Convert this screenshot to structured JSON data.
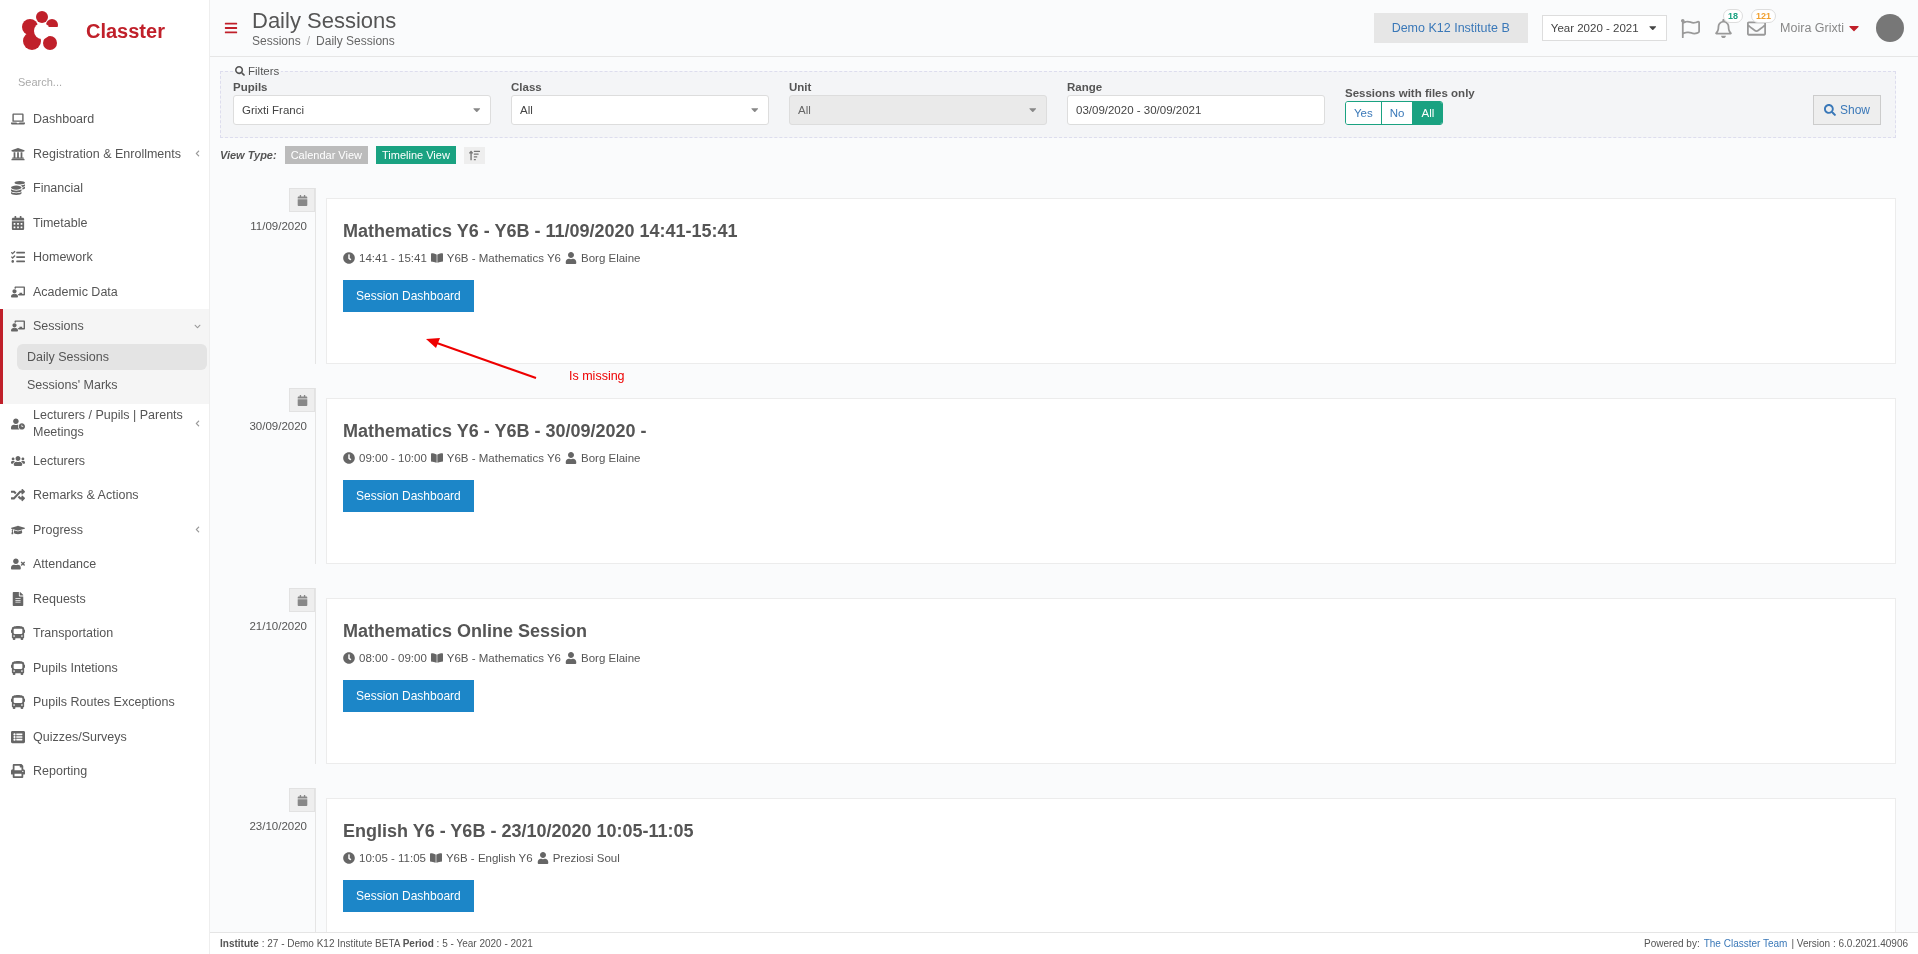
{
  "brand": {
    "name": "Classter"
  },
  "sidebar": {
    "search_placeholder": "Search...",
    "items": [
      {
        "label": "Dashboard"
      },
      {
        "label": "Registration & Enrollments",
        "expanded": false
      },
      {
        "label": "Financial"
      },
      {
        "label": "Timetable"
      },
      {
        "label": "Homework"
      },
      {
        "label": "Academic Data"
      },
      {
        "label": "Sessions",
        "expanded": true,
        "children": [
          {
            "label": "Daily Sessions",
            "selected": true
          },
          {
            "label": "Sessions' Marks",
            "selected": false
          }
        ]
      },
      {
        "label": "Lecturers / Pupils | Parents Meetings",
        "expanded": false
      },
      {
        "label": "Lecturers"
      },
      {
        "label": "Remarks & Actions"
      },
      {
        "label": "Progress",
        "expanded": false
      },
      {
        "label": "Attendance"
      },
      {
        "label": "Requests"
      },
      {
        "label": "Transportation"
      },
      {
        "label": "Pupils Intetions"
      },
      {
        "label": "Pupils Routes Exceptions"
      },
      {
        "label": "Quizzes/Surveys"
      },
      {
        "label": "Reporting"
      }
    ]
  },
  "header": {
    "title": "Daily Sessions",
    "breadcrumb": [
      "Sessions",
      "Daily Sessions"
    ],
    "breadcrumb_separator": "/",
    "institute": "Demo K12 Institute B",
    "year": "Year 2020 - 2021",
    "notifications": "18",
    "messages": "121",
    "user": "Moira Grixti"
  },
  "filters": {
    "legend": "Filters",
    "fields": [
      {
        "label": "Pupils",
        "kind": "select",
        "value": "Grixti Franci",
        "disabled": false
      },
      {
        "label": "Class",
        "kind": "select",
        "value": "All",
        "disabled": false
      },
      {
        "label": "Unit",
        "kind": "select",
        "value": "All",
        "disabled": true
      },
      {
        "label": "Range",
        "kind": "date",
        "value": "03/09/2020 - 30/09/2021",
        "disabled": false
      }
    ],
    "files_only": {
      "label": "Sessions with files only",
      "options": [
        {
          "label": "Yes",
          "selected": false
        },
        {
          "label": "No",
          "selected": false
        },
        {
          "label": "All",
          "selected": true
        }
      ]
    },
    "show_button": "Show"
  },
  "view_type": {
    "label": "View Type:",
    "options": [
      {
        "label": "Calendar View",
        "selected": false
      },
      {
        "label": "Timeline View",
        "selected": true
      }
    ]
  },
  "sessions": [
    {
      "date": "11/09/2020",
      "title": "Mathematics Y6 - Y6B - 11/09/2020 14:41-15:41",
      "time": "14:41 - 15:41",
      "class": "Y6B - Mathematics Y6",
      "lecturer": "Borg Elaine",
      "button": "Session Dashboard"
    },
    {
      "date": "30/09/2020",
      "title": "Mathematics Y6 - Y6B - 30/09/2020 -",
      "time": "09:00 - 10:00",
      "class": "Y6B - Mathematics Y6",
      "lecturer": "Borg Elaine",
      "button": "Session Dashboard"
    },
    {
      "date": "21/10/2020",
      "title": "Mathematics Online Session",
      "time": "08:00 - 09:00",
      "class": "Y6B - Mathematics Y6",
      "lecturer": "Borg Elaine",
      "button": "Session Dashboard"
    },
    {
      "date": "23/10/2020",
      "title": "English Y6 - Y6B - 23/10/2020 10:05-11:05",
      "time": "10:05 - 11:05",
      "class": "Y6B - English Y6",
      "lecturer": "Preziosi Soul",
      "button": "Session Dashboard"
    }
  ],
  "annotation": {
    "text": "Is missing"
  },
  "footer": {
    "info": "**Institute** : 27 - Demo K12 Institute BETA **Period** : 5 - Year 2020 - 2021",
    "powered_by": "Powered by:",
    "team_link": "The Classter Team",
    "version": "| Version : 6.0.2021.40906"
  }
}
